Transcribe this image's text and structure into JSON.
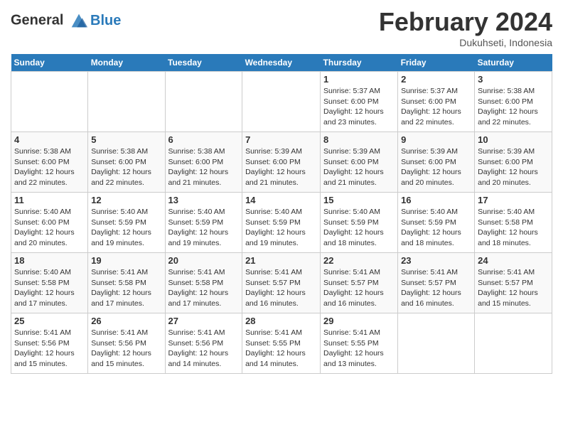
{
  "header": {
    "logo_line1": "General",
    "logo_line2": "Blue",
    "month_title": "February 2024",
    "subtitle": "Dukuhseti, Indonesia"
  },
  "days_of_week": [
    "Sunday",
    "Monday",
    "Tuesday",
    "Wednesday",
    "Thursday",
    "Friday",
    "Saturday"
  ],
  "weeks": [
    [
      {
        "day": "",
        "detail": ""
      },
      {
        "day": "",
        "detail": ""
      },
      {
        "day": "",
        "detail": ""
      },
      {
        "day": "",
        "detail": ""
      },
      {
        "day": "1",
        "detail": "Sunrise: 5:37 AM\nSunset: 6:00 PM\nDaylight: 12 hours\nand 23 minutes."
      },
      {
        "day": "2",
        "detail": "Sunrise: 5:37 AM\nSunset: 6:00 PM\nDaylight: 12 hours\nand 22 minutes."
      },
      {
        "day": "3",
        "detail": "Sunrise: 5:38 AM\nSunset: 6:00 PM\nDaylight: 12 hours\nand 22 minutes."
      }
    ],
    [
      {
        "day": "4",
        "detail": "Sunrise: 5:38 AM\nSunset: 6:00 PM\nDaylight: 12 hours\nand 22 minutes."
      },
      {
        "day": "5",
        "detail": "Sunrise: 5:38 AM\nSunset: 6:00 PM\nDaylight: 12 hours\nand 22 minutes."
      },
      {
        "day": "6",
        "detail": "Sunrise: 5:38 AM\nSunset: 6:00 PM\nDaylight: 12 hours\nand 21 minutes."
      },
      {
        "day": "7",
        "detail": "Sunrise: 5:39 AM\nSunset: 6:00 PM\nDaylight: 12 hours\nand 21 minutes."
      },
      {
        "day": "8",
        "detail": "Sunrise: 5:39 AM\nSunset: 6:00 PM\nDaylight: 12 hours\nand 21 minutes."
      },
      {
        "day": "9",
        "detail": "Sunrise: 5:39 AM\nSunset: 6:00 PM\nDaylight: 12 hours\nand 20 minutes."
      },
      {
        "day": "10",
        "detail": "Sunrise: 5:39 AM\nSunset: 6:00 PM\nDaylight: 12 hours\nand 20 minutes."
      }
    ],
    [
      {
        "day": "11",
        "detail": "Sunrise: 5:40 AM\nSunset: 6:00 PM\nDaylight: 12 hours\nand 20 minutes."
      },
      {
        "day": "12",
        "detail": "Sunrise: 5:40 AM\nSunset: 5:59 PM\nDaylight: 12 hours\nand 19 minutes."
      },
      {
        "day": "13",
        "detail": "Sunrise: 5:40 AM\nSunset: 5:59 PM\nDaylight: 12 hours\nand 19 minutes."
      },
      {
        "day": "14",
        "detail": "Sunrise: 5:40 AM\nSunset: 5:59 PM\nDaylight: 12 hours\nand 19 minutes."
      },
      {
        "day": "15",
        "detail": "Sunrise: 5:40 AM\nSunset: 5:59 PM\nDaylight: 12 hours\nand 18 minutes."
      },
      {
        "day": "16",
        "detail": "Sunrise: 5:40 AM\nSunset: 5:59 PM\nDaylight: 12 hours\nand 18 minutes."
      },
      {
        "day": "17",
        "detail": "Sunrise: 5:40 AM\nSunset: 5:58 PM\nDaylight: 12 hours\nand 18 minutes."
      }
    ],
    [
      {
        "day": "18",
        "detail": "Sunrise: 5:40 AM\nSunset: 5:58 PM\nDaylight: 12 hours\nand 17 minutes."
      },
      {
        "day": "19",
        "detail": "Sunrise: 5:41 AM\nSunset: 5:58 PM\nDaylight: 12 hours\nand 17 minutes."
      },
      {
        "day": "20",
        "detail": "Sunrise: 5:41 AM\nSunset: 5:58 PM\nDaylight: 12 hours\nand 17 minutes."
      },
      {
        "day": "21",
        "detail": "Sunrise: 5:41 AM\nSunset: 5:57 PM\nDaylight: 12 hours\nand 16 minutes."
      },
      {
        "day": "22",
        "detail": "Sunrise: 5:41 AM\nSunset: 5:57 PM\nDaylight: 12 hours\nand 16 minutes."
      },
      {
        "day": "23",
        "detail": "Sunrise: 5:41 AM\nSunset: 5:57 PM\nDaylight: 12 hours\nand 16 minutes."
      },
      {
        "day": "24",
        "detail": "Sunrise: 5:41 AM\nSunset: 5:57 PM\nDaylight: 12 hours\nand 15 minutes."
      }
    ],
    [
      {
        "day": "25",
        "detail": "Sunrise: 5:41 AM\nSunset: 5:56 PM\nDaylight: 12 hours\nand 15 minutes."
      },
      {
        "day": "26",
        "detail": "Sunrise: 5:41 AM\nSunset: 5:56 PM\nDaylight: 12 hours\nand 15 minutes."
      },
      {
        "day": "27",
        "detail": "Sunrise: 5:41 AM\nSunset: 5:56 PM\nDaylight: 12 hours\nand 14 minutes."
      },
      {
        "day": "28",
        "detail": "Sunrise: 5:41 AM\nSunset: 5:55 PM\nDaylight: 12 hours\nand 14 minutes."
      },
      {
        "day": "29",
        "detail": "Sunrise: 5:41 AM\nSunset: 5:55 PM\nDaylight: 12 hours\nand 13 minutes."
      },
      {
        "day": "",
        "detail": ""
      },
      {
        "day": "",
        "detail": ""
      }
    ]
  ]
}
